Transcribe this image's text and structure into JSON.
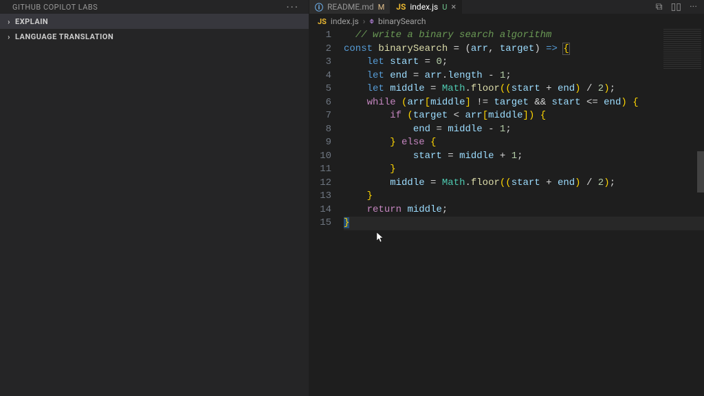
{
  "sidebar": {
    "title": "GITHUB COPILOT LABS",
    "sections": [
      {
        "label": "EXPLAIN",
        "selected": true
      },
      {
        "label": "LANGUAGE TRANSLATION",
        "selected": false
      }
    ]
  },
  "tabs": [
    {
      "icon": "ⓘ",
      "icon_color": "#75beff",
      "name": "README.md",
      "status": "M",
      "status_color": "#e2c08d",
      "active": false
    },
    {
      "icon": "JS",
      "icon_color": "#e9b731",
      "name": "index.js",
      "status": "U",
      "status_color": "#73c991",
      "active": true,
      "closable": true
    }
  ],
  "breadcrumb": {
    "file_icon": "JS",
    "file": "index.js",
    "symbol_icon": "⌽",
    "symbol": "binarySearch"
  },
  "code": {
    "lines": [
      {
        "n": 1,
        "tokens": [
          [
            "  ",
            "op"
          ],
          [
            "// write a binary search algorithm",
            "cmt"
          ]
        ]
      },
      {
        "n": 2,
        "tokens": [
          [
            "const",
            "decl"
          ],
          [
            " ",
            "op"
          ],
          [
            "binarySearch",
            "fn"
          ],
          [
            " = (",
            "op"
          ],
          [
            "arr",
            "var"
          ],
          [
            ", ",
            "op"
          ],
          [
            "target",
            "var"
          ],
          [
            ") ",
            "op"
          ],
          [
            "=>",
            "decl"
          ],
          [
            " ",
            "op"
          ],
          [
            "{",
            "brace-match"
          ]
        ]
      },
      {
        "n": 3,
        "tokens": [
          [
            "    ",
            "op"
          ],
          [
            "let",
            "decl"
          ],
          [
            " ",
            "op"
          ],
          [
            "start",
            "var"
          ],
          [
            " = ",
            "op"
          ],
          [
            "0",
            "num"
          ],
          [
            ";",
            "op"
          ]
        ]
      },
      {
        "n": 4,
        "tokens": [
          [
            "    ",
            "op"
          ],
          [
            "let",
            "decl"
          ],
          [
            " ",
            "op"
          ],
          [
            "end",
            "var"
          ],
          [
            " = ",
            "op"
          ],
          [
            "arr",
            "var"
          ],
          [
            ".",
            "op"
          ],
          [
            "length",
            "var"
          ],
          [
            " - ",
            "op"
          ],
          [
            "1",
            "num"
          ],
          [
            ";",
            "op"
          ]
        ]
      },
      {
        "n": 5,
        "tokens": [
          [
            "    ",
            "op"
          ],
          [
            "let",
            "decl"
          ],
          [
            " ",
            "op"
          ],
          [
            "middle",
            "var"
          ],
          [
            " = ",
            "op"
          ],
          [
            "Math",
            "cls"
          ],
          [
            ".",
            "op"
          ],
          [
            "floor",
            "fn"
          ],
          [
            "((",
            "pun-y"
          ],
          [
            "start",
            "var"
          ],
          [
            " + ",
            "op"
          ],
          [
            "end",
            "var"
          ],
          [
            ")",
            "pun-y"
          ],
          [
            " / ",
            "op"
          ],
          [
            "2",
            "num"
          ],
          [
            ")",
            "pun-y"
          ],
          [
            ";",
            "op"
          ]
        ]
      },
      {
        "n": 6,
        "tokens": [
          [
            "    ",
            "op"
          ],
          [
            "while",
            "kw"
          ],
          [
            " (",
            "pun-y"
          ],
          [
            "arr",
            "var"
          ],
          [
            "[",
            "pun-y"
          ],
          [
            "middle",
            "var"
          ],
          [
            "]",
            "pun-y"
          ],
          [
            " != ",
            "op"
          ],
          [
            "target",
            "var"
          ],
          [
            " && ",
            "op"
          ],
          [
            "start",
            "var"
          ],
          [
            " <= ",
            "op"
          ],
          [
            "end",
            "var"
          ],
          [
            ") ",
            "pun-y"
          ],
          [
            "{",
            "pun-y"
          ]
        ]
      },
      {
        "n": 7,
        "tokens": [
          [
            "        ",
            "op"
          ],
          [
            "if",
            "kw"
          ],
          [
            " (",
            "pun-y"
          ],
          [
            "target",
            "var"
          ],
          [
            " < ",
            "op"
          ],
          [
            "arr",
            "var"
          ],
          [
            "[",
            "pun-y"
          ],
          [
            "middle",
            "var"
          ],
          [
            "]",
            "pun-y"
          ],
          [
            ") ",
            "pun-y"
          ],
          [
            "{",
            "pun-y"
          ]
        ]
      },
      {
        "n": 8,
        "tokens": [
          [
            "            ",
            "op"
          ],
          [
            "end",
            "var"
          ],
          [
            " = ",
            "op"
          ],
          [
            "middle",
            "var"
          ],
          [
            " - ",
            "op"
          ],
          [
            "1",
            "num"
          ],
          [
            ";",
            "op"
          ]
        ]
      },
      {
        "n": 9,
        "tokens": [
          [
            "        ",
            "op"
          ],
          [
            "}",
            "pun-y"
          ],
          [
            " ",
            "op"
          ],
          [
            "else",
            "kw"
          ],
          [
            " ",
            "op"
          ],
          [
            "{",
            "pun-y"
          ]
        ]
      },
      {
        "n": 10,
        "tokens": [
          [
            "            ",
            "op"
          ],
          [
            "start",
            "var"
          ],
          [
            " = ",
            "op"
          ],
          [
            "middle",
            "var"
          ],
          [
            " + ",
            "op"
          ],
          [
            "1",
            "num"
          ],
          [
            ";",
            "op"
          ]
        ]
      },
      {
        "n": 11,
        "tokens": [
          [
            "        ",
            "op"
          ],
          [
            "}",
            "pun-y"
          ]
        ]
      },
      {
        "n": 12,
        "tokens": [
          [
            "        ",
            "op"
          ],
          [
            "middle",
            "var"
          ],
          [
            " = ",
            "op"
          ],
          [
            "Math",
            "cls"
          ],
          [
            ".",
            "op"
          ],
          [
            "floor",
            "fn"
          ],
          [
            "((",
            "pun-y"
          ],
          [
            "start",
            "var"
          ],
          [
            " + ",
            "op"
          ],
          [
            "end",
            "var"
          ],
          [
            ")",
            "pun-y"
          ],
          [
            " / ",
            "op"
          ],
          [
            "2",
            "num"
          ],
          [
            ")",
            "pun-y"
          ],
          [
            ";",
            "op"
          ]
        ]
      },
      {
        "n": 13,
        "tokens": [
          [
            "    ",
            "op"
          ],
          [
            "}",
            "pun-y"
          ]
        ]
      },
      {
        "n": 14,
        "tokens": [
          [
            "    ",
            "op"
          ],
          [
            "return",
            "kw"
          ],
          [
            " ",
            "op"
          ],
          [
            "middle",
            "var"
          ],
          [
            ";",
            "op"
          ]
        ]
      },
      {
        "n": 15,
        "current": true,
        "tokens": [
          [
            "}",
            "brace-sel"
          ]
        ]
      }
    ]
  },
  "glyphs": {
    "ellipsis": "···",
    "chevron_right": "›",
    "close": "×",
    "split": "▯▯",
    "compare": "⧉"
  }
}
